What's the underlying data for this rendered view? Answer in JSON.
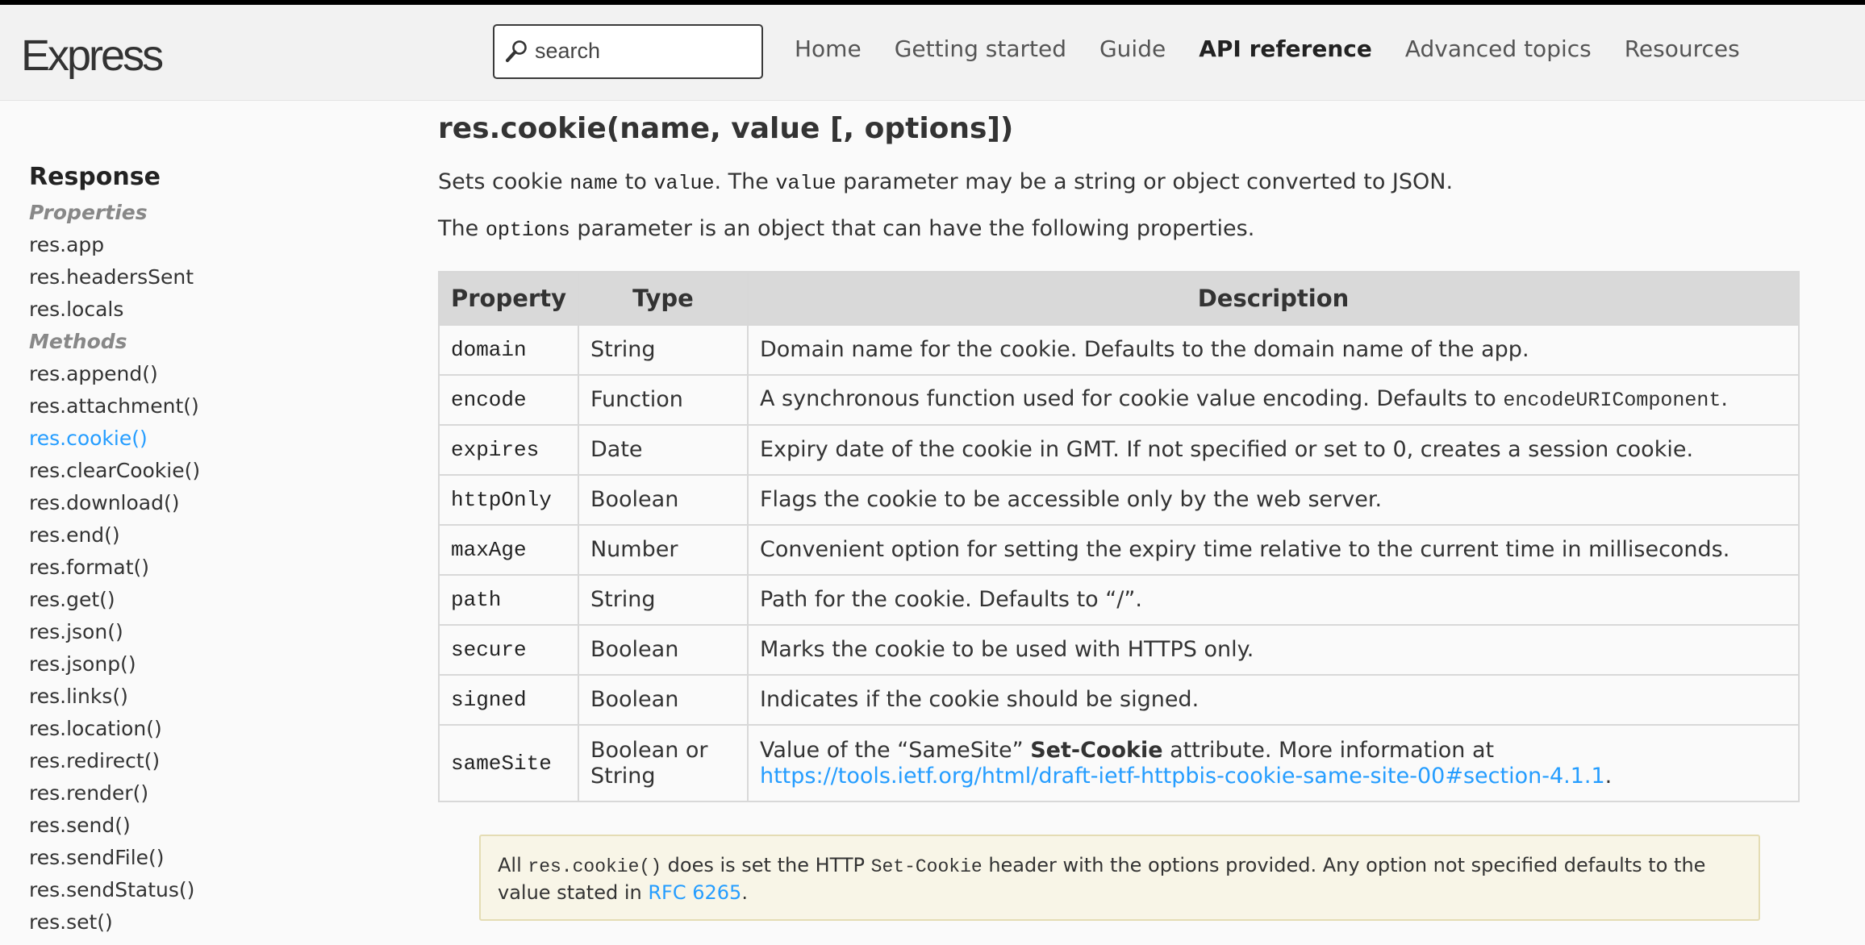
{
  "header": {
    "logo": "Express",
    "search_placeholder": "search",
    "nav": [
      "Home",
      "Getting started",
      "Guide",
      "API reference",
      "Advanced topics",
      "Resources"
    ],
    "active_nav": "API reference"
  },
  "sidebar": {
    "title": "Response",
    "properties_label": "Properties",
    "properties": [
      "res.app",
      "res.headersSent",
      "res.locals"
    ],
    "methods_label": "Methods",
    "methods": [
      "res.append()",
      "res.attachment()",
      "res.cookie()",
      "res.clearCookie()",
      "res.download()",
      "res.end()",
      "res.format()",
      "res.get()",
      "res.json()",
      "res.jsonp()",
      "res.links()",
      "res.location()",
      "res.redirect()",
      "res.render()",
      "res.send()",
      "res.sendFile()",
      "res.sendStatus()",
      "res.set()"
    ],
    "active_item": "res.cookie()"
  },
  "main": {
    "title": "res.cookie(name, value [, options])",
    "intro": {
      "t1": "Sets cookie ",
      "c1": "name",
      "t2": " to ",
      "c2": "value",
      "t3": ". The ",
      "c3": "value",
      "t4": " parameter may be a string or object converted to JSON."
    },
    "options_text": {
      "t1": "The ",
      "c1": "options",
      "t2": " parameter is an object that can have the following properties."
    },
    "table": {
      "headers": [
        "Property",
        "Type",
        "Description"
      ],
      "rows": [
        {
          "property": "domain",
          "type": "String",
          "description": "Domain name for the cookie. Defaults to the domain name of the app."
        },
        {
          "property": "encode",
          "type": "Function",
          "description": "A synchronous function used for cookie value encoding. Defaults to ",
          "code": "encodeURIComponent",
          "description_end": "."
        },
        {
          "property": "expires",
          "type": "Date",
          "description": "Expiry date of the cookie in GMT. If not specified or set to 0, creates a session cookie."
        },
        {
          "property": "httpOnly",
          "type": "Boolean",
          "description": "Flags the cookie to be accessible only by the web server."
        },
        {
          "property": "maxAge",
          "type": "Number",
          "description": "Convenient option for setting the expiry time relative to the current time in milliseconds."
        },
        {
          "property": "path",
          "type": "String",
          "description": "Path for the cookie. Defaults to “/”."
        },
        {
          "property": "secure",
          "type": "Boolean",
          "description": "Marks the cookie to be used with HTTPS only."
        },
        {
          "property": "signed",
          "type": "Boolean",
          "description": "Indicates if the cookie should be signed."
        },
        {
          "property": "sameSite",
          "type": "Boolean or String",
          "description": "Value of the “SameSite” ",
          "bold": "Set-Cookie",
          "description_mid": " attribute. More information at ",
          "link": "https://tools.ietf.org/html/draft-ietf-httpbis-cookie-same-site-00#section-4.1.1",
          "description_end": "."
        }
      ]
    },
    "note": {
      "t1": "All ",
      "c1": "res.cookie()",
      "t2": " does is set the HTTP ",
      "c2": "Set-Cookie",
      "t3": " header with the options provided. Any option not specified defaults to the value stated in ",
      "link": "RFC 6265",
      "t4": "."
    }
  },
  "colors": {
    "link": "#259dff",
    "note_background": "#f8f5e7",
    "table_header": "#d9d9d9",
    "top_border": "#000000"
  }
}
